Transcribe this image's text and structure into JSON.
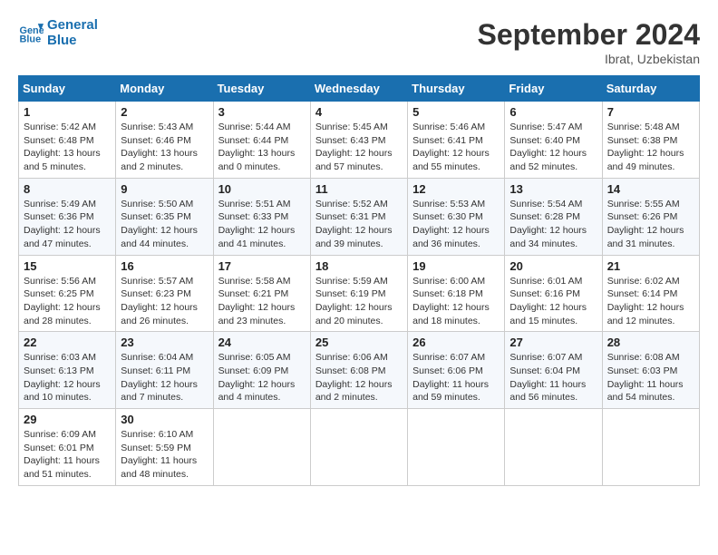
{
  "header": {
    "logo_line1": "General",
    "logo_line2": "Blue",
    "month": "September 2024",
    "location": "Ibrat, Uzbekistan"
  },
  "weekdays": [
    "Sunday",
    "Monday",
    "Tuesday",
    "Wednesday",
    "Thursday",
    "Friday",
    "Saturday"
  ],
  "weeks": [
    [
      {
        "day": "1",
        "info": "Sunrise: 5:42 AM\nSunset: 6:48 PM\nDaylight: 13 hours\nand 5 minutes."
      },
      {
        "day": "2",
        "info": "Sunrise: 5:43 AM\nSunset: 6:46 PM\nDaylight: 13 hours\nand 2 minutes."
      },
      {
        "day": "3",
        "info": "Sunrise: 5:44 AM\nSunset: 6:44 PM\nDaylight: 13 hours\nand 0 minutes."
      },
      {
        "day": "4",
        "info": "Sunrise: 5:45 AM\nSunset: 6:43 PM\nDaylight: 12 hours\nand 57 minutes."
      },
      {
        "day": "5",
        "info": "Sunrise: 5:46 AM\nSunset: 6:41 PM\nDaylight: 12 hours\nand 55 minutes."
      },
      {
        "day": "6",
        "info": "Sunrise: 5:47 AM\nSunset: 6:40 PM\nDaylight: 12 hours\nand 52 minutes."
      },
      {
        "day": "7",
        "info": "Sunrise: 5:48 AM\nSunset: 6:38 PM\nDaylight: 12 hours\nand 49 minutes."
      }
    ],
    [
      {
        "day": "8",
        "info": "Sunrise: 5:49 AM\nSunset: 6:36 PM\nDaylight: 12 hours\nand 47 minutes."
      },
      {
        "day": "9",
        "info": "Sunrise: 5:50 AM\nSunset: 6:35 PM\nDaylight: 12 hours\nand 44 minutes."
      },
      {
        "day": "10",
        "info": "Sunrise: 5:51 AM\nSunset: 6:33 PM\nDaylight: 12 hours\nand 41 minutes."
      },
      {
        "day": "11",
        "info": "Sunrise: 5:52 AM\nSunset: 6:31 PM\nDaylight: 12 hours\nand 39 minutes."
      },
      {
        "day": "12",
        "info": "Sunrise: 5:53 AM\nSunset: 6:30 PM\nDaylight: 12 hours\nand 36 minutes."
      },
      {
        "day": "13",
        "info": "Sunrise: 5:54 AM\nSunset: 6:28 PM\nDaylight: 12 hours\nand 34 minutes."
      },
      {
        "day": "14",
        "info": "Sunrise: 5:55 AM\nSunset: 6:26 PM\nDaylight: 12 hours\nand 31 minutes."
      }
    ],
    [
      {
        "day": "15",
        "info": "Sunrise: 5:56 AM\nSunset: 6:25 PM\nDaylight: 12 hours\nand 28 minutes."
      },
      {
        "day": "16",
        "info": "Sunrise: 5:57 AM\nSunset: 6:23 PM\nDaylight: 12 hours\nand 26 minutes."
      },
      {
        "day": "17",
        "info": "Sunrise: 5:58 AM\nSunset: 6:21 PM\nDaylight: 12 hours\nand 23 minutes."
      },
      {
        "day": "18",
        "info": "Sunrise: 5:59 AM\nSunset: 6:19 PM\nDaylight: 12 hours\nand 20 minutes."
      },
      {
        "day": "19",
        "info": "Sunrise: 6:00 AM\nSunset: 6:18 PM\nDaylight: 12 hours\nand 18 minutes."
      },
      {
        "day": "20",
        "info": "Sunrise: 6:01 AM\nSunset: 6:16 PM\nDaylight: 12 hours\nand 15 minutes."
      },
      {
        "day": "21",
        "info": "Sunrise: 6:02 AM\nSunset: 6:14 PM\nDaylight: 12 hours\nand 12 minutes."
      }
    ],
    [
      {
        "day": "22",
        "info": "Sunrise: 6:03 AM\nSunset: 6:13 PM\nDaylight: 12 hours\nand 10 minutes."
      },
      {
        "day": "23",
        "info": "Sunrise: 6:04 AM\nSunset: 6:11 PM\nDaylight: 12 hours\nand 7 minutes."
      },
      {
        "day": "24",
        "info": "Sunrise: 6:05 AM\nSunset: 6:09 PM\nDaylight: 12 hours\nand 4 minutes."
      },
      {
        "day": "25",
        "info": "Sunrise: 6:06 AM\nSunset: 6:08 PM\nDaylight: 12 hours\nand 2 minutes."
      },
      {
        "day": "26",
        "info": "Sunrise: 6:07 AM\nSunset: 6:06 PM\nDaylight: 11 hours\nand 59 minutes."
      },
      {
        "day": "27",
        "info": "Sunrise: 6:07 AM\nSunset: 6:04 PM\nDaylight: 11 hours\nand 56 minutes."
      },
      {
        "day": "28",
        "info": "Sunrise: 6:08 AM\nSunset: 6:03 PM\nDaylight: 11 hours\nand 54 minutes."
      }
    ],
    [
      {
        "day": "29",
        "info": "Sunrise: 6:09 AM\nSunset: 6:01 PM\nDaylight: 11 hours\nand 51 minutes."
      },
      {
        "day": "30",
        "info": "Sunrise: 6:10 AM\nSunset: 5:59 PM\nDaylight: 11 hours\nand 48 minutes."
      },
      null,
      null,
      null,
      null,
      null
    ]
  ]
}
